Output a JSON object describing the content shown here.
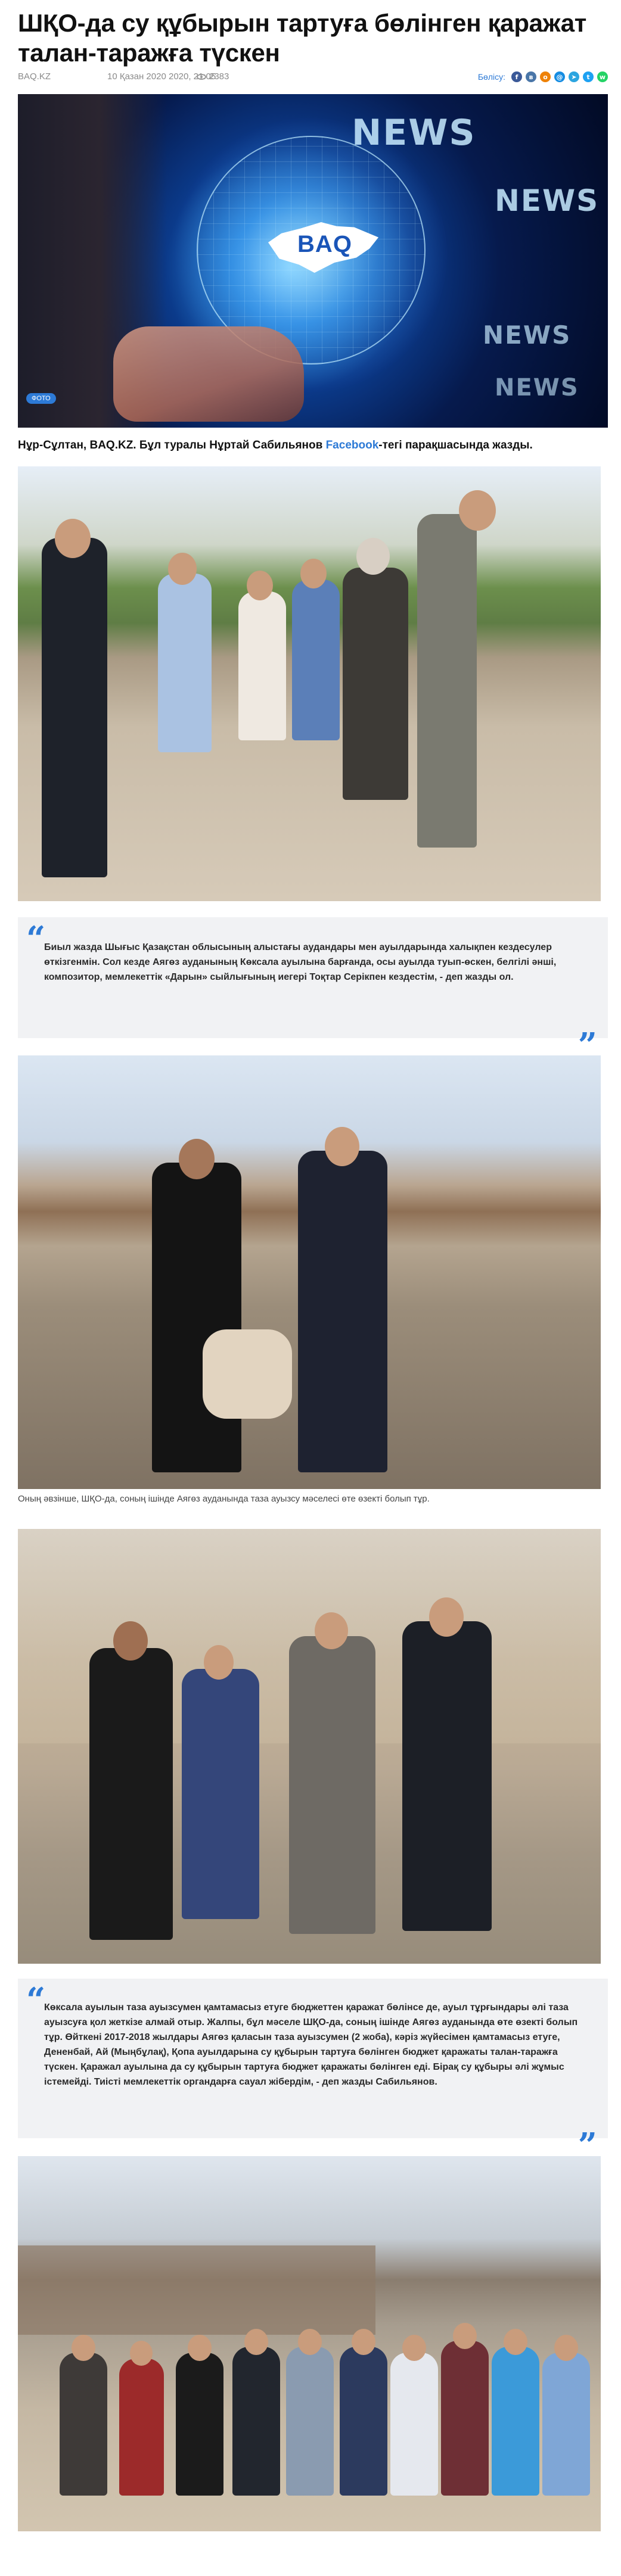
{
  "article": {
    "title": "ШҚО-да су құбырын тартуға бөлінген қаражат талан-таражға түскен",
    "source": "BAQ.KZ",
    "date": "10 Қазан 2020 2020, 21:05",
    "views": "2383",
    "share_label": "Бөлісу:",
    "share_icons": [
      {
        "name": "facebook-icon",
        "glyph": "f",
        "color": "#3b5998"
      },
      {
        "name": "vk-icon",
        "glyph": "в",
        "color": "#4a76a8"
      },
      {
        "name": "odnoklassniki-icon",
        "glyph": "o",
        "color": "#ee8208"
      },
      {
        "name": "mailru-icon",
        "glyph": "@",
        "color": "#168de2"
      },
      {
        "name": "telegram-icon",
        "glyph": "➤",
        "color": "#2ca5e0"
      },
      {
        "name": "twitter-icon",
        "glyph": "t",
        "color": "#1da1f2"
      },
      {
        "name": "whatsapp-icon",
        "glyph": "w",
        "color": "#25d366"
      }
    ],
    "hero": {
      "logo_text": "BAQ",
      "news_words": [
        "NEWS",
        "NEWS",
        "NEWS",
        "NEWS"
      ],
      "badge": "ФОТО"
    },
    "lede_before": "Нұр-Сұлтан, BAQ.KZ. Бұл туралы Нұртай Сабильянов ",
    "lede_link": "Facebook",
    "lede_after": "-тегі парақшасында жазды.",
    "quote1": "Биыл жазда Шығыс Қазақстан облысының алыстағы аудандары мен ауылдарында халықпен кездесулер өткізгенмін. Сол кезде Аягөз ауданының Көксала ауылына барғанда, осы ауылда туып-өскен, белгілі әнші, композитор, мемлекеттік «Дарын» сыйлығының иегері Тоқтар Серікпен кездестім, - деп жазды ол.",
    "caption2": "Оның əвзінше, ШҚО-да, соның ішінде Аягөз ауданында таза ауызсу мəселесі өте өзекті болып тұр.",
    "quote2": "Көксала ауылын таза ауызсумен қамтамасыз етуге бюджеттен қаражат бөлінсе де, ауыл тұрғындары әлі таза ауызсуға қол жеткізе алмай отыр. Жалпы, бұл мәселе ШҚО-да, соның ішінде Аягөз ауданында өте өзекті болып тұр. Өйткені 2017-2018 жылдары Аягөз қаласын таза ауызсумен (2 жоба), кәріз жүйесімен қамтамасыз етуге, Дененбай, Ай (Мыңбұлақ), Қопа ауылдарына су құбырын тартуға бөлінген бюджет қаражаты талан-таражға түскен. Қаражал ауылына да су құбырын тартуға бюджет қаражаты бөлінген еді. Бірақ су құбыры әлі жұмыс істемейді. Тиісті мемлекеттік органдарға сауал жібердім, - деп жазды Сабильянов.",
    "quote_open": "“",
    "quote_close": "”"
  }
}
